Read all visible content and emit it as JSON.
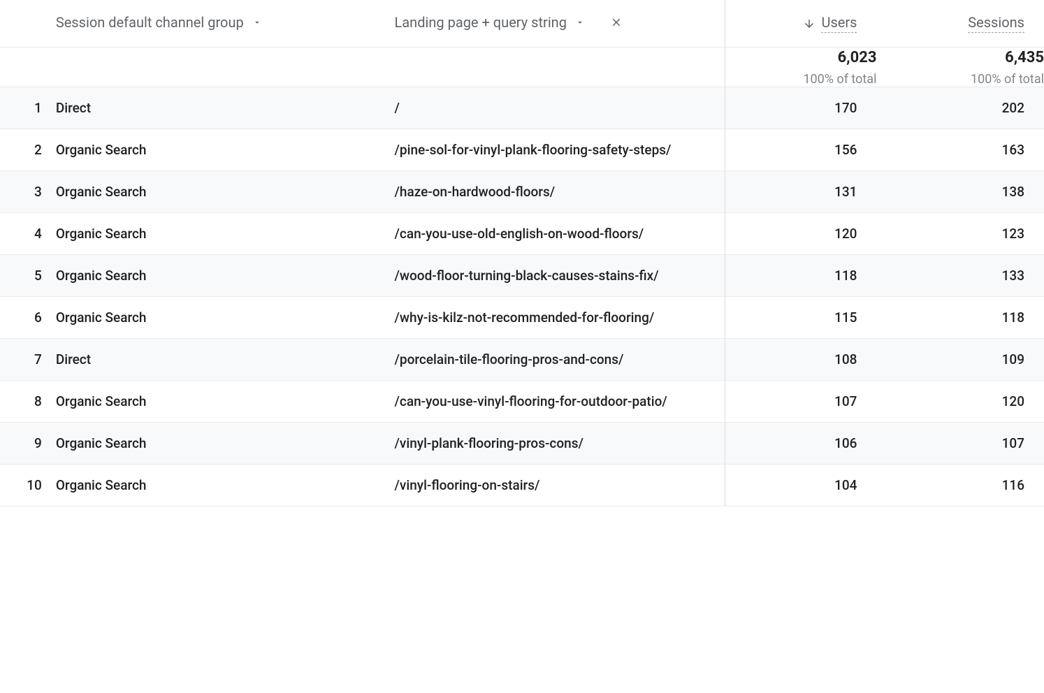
{
  "dimensions": {
    "primary": {
      "label": "Session default channel group"
    },
    "secondary": {
      "label": "Landing page + query string"
    }
  },
  "metrics": {
    "users": {
      "label": "Users",
      "total": "6,023",
      "subtext": "100% of total",
      "sorted": true
    },
    "sessions": {
      "label": "Sessions",
      "total": "6,435",
      "subtext": "100% of total",
      "sorted": false
    }
  },
  "rows": [
    {
      "idx": "1",
      "channel": "Direct",
      "page": "/",
      "users": "170",
      "sessions": "202"
    },
    {
      "idx": "2",
      "channel": "Organic Search",
      "page": "/pine-sol-for-vinyl-plank-flooring-safety-steps/",
      "users": "156",
      "sessions": "163"
    },
    {
      "idx": "3",
      "channel": "Organic Search",
      "page": "/haze-on-hardwood-floors/",
      "users": "131",
      "sessions": "138"
    },
    {
      "idx": "4",
      "channel": "Organic Search",
      "page": "/can-you-use-old-english-on-wood-floors/",
      "users": "120",
      "sessions": "123"
    },
    {
      "idx": "5",
      "channel": "Organic Search",
      "page": "/wood-floor-turning-black-causes-stains-fix/",
      "users": "118",
      "sessions": "133"
    },
    {
      "idx": "6",
      "channel": "Organic Search",
      "page": "/why-is-kilz-not-recommended-for-flooring/",
      "users": "115",
      "sessions": "118"
    },
    {
      "idx": "7",
      "channel": "Direct",
      "page": "/porcelain-tile-flooring-pros-and-cons/",
      "users": "108",
      "sessions": "109"
    },
    {
      "idx": "8",
      "channel": "Organic Search",
      "page": "/can-you-use-vinyl-flooring-for-outdoor-patio/",
      "users": "107",
      "sessions": "120"
    },
    {
      "idx": "9",
      "channel": "Organic Search",
      "page": "/vinyl-plank-flooring-pros-cons/",
      "users": "106",
      "sessions": "107"
    },
    {
      "idx": "10",
      "channel": "Organic Search",
      "page": "/vinyl-flooring-on-stairs/",
      "users": "104",
      "sessions": "116"
    }
  ]
}
